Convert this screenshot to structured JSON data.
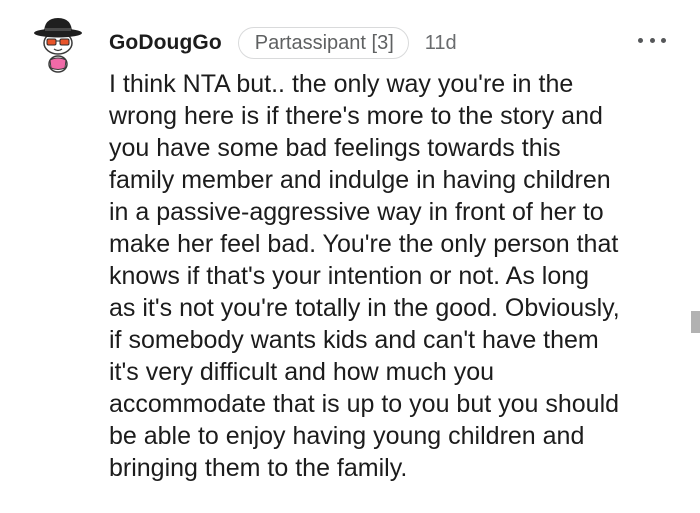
{
  "comment": {
    "username": "GoDougGo",
    "flair": "Partassipant [3]",
    "age": "11d",
    "more_icon": "ellipsis-horizontal-icon",
    "avatar_icon": "snoo-avatar-icon",
    "body_lines": [
      "I think NTA but.. the only way you're in the",
      "wrong here is if there's more to the story and",
      "you have some bad feelings towards this",
      "family member and indulge in having children",
      "in a passive-aggressive way in front of her to",
      "make her feel bad. You're the only person that",
      "knows if that's your intention or not. As long",
      "as it's not you're totally in the good. Obviously,",
      "if somebody wants kids and can't have them",
      "it's very difficult and how much you",
      "accommodate that is up to you but you should",
      "be able to enjoy having young children and",
      "bringing them to the family."
    ]
  },
  "colors": {
    "text": "#1c1c1c",
    "meta": "#6a6c6e",
    "flair_border": "#d9dadb",
    "avatar_hat": "#1f1f1f",
    "avatar_glasses": "#e8542a",
    "avatar_shirt": "#f06aa8"
  }
}
